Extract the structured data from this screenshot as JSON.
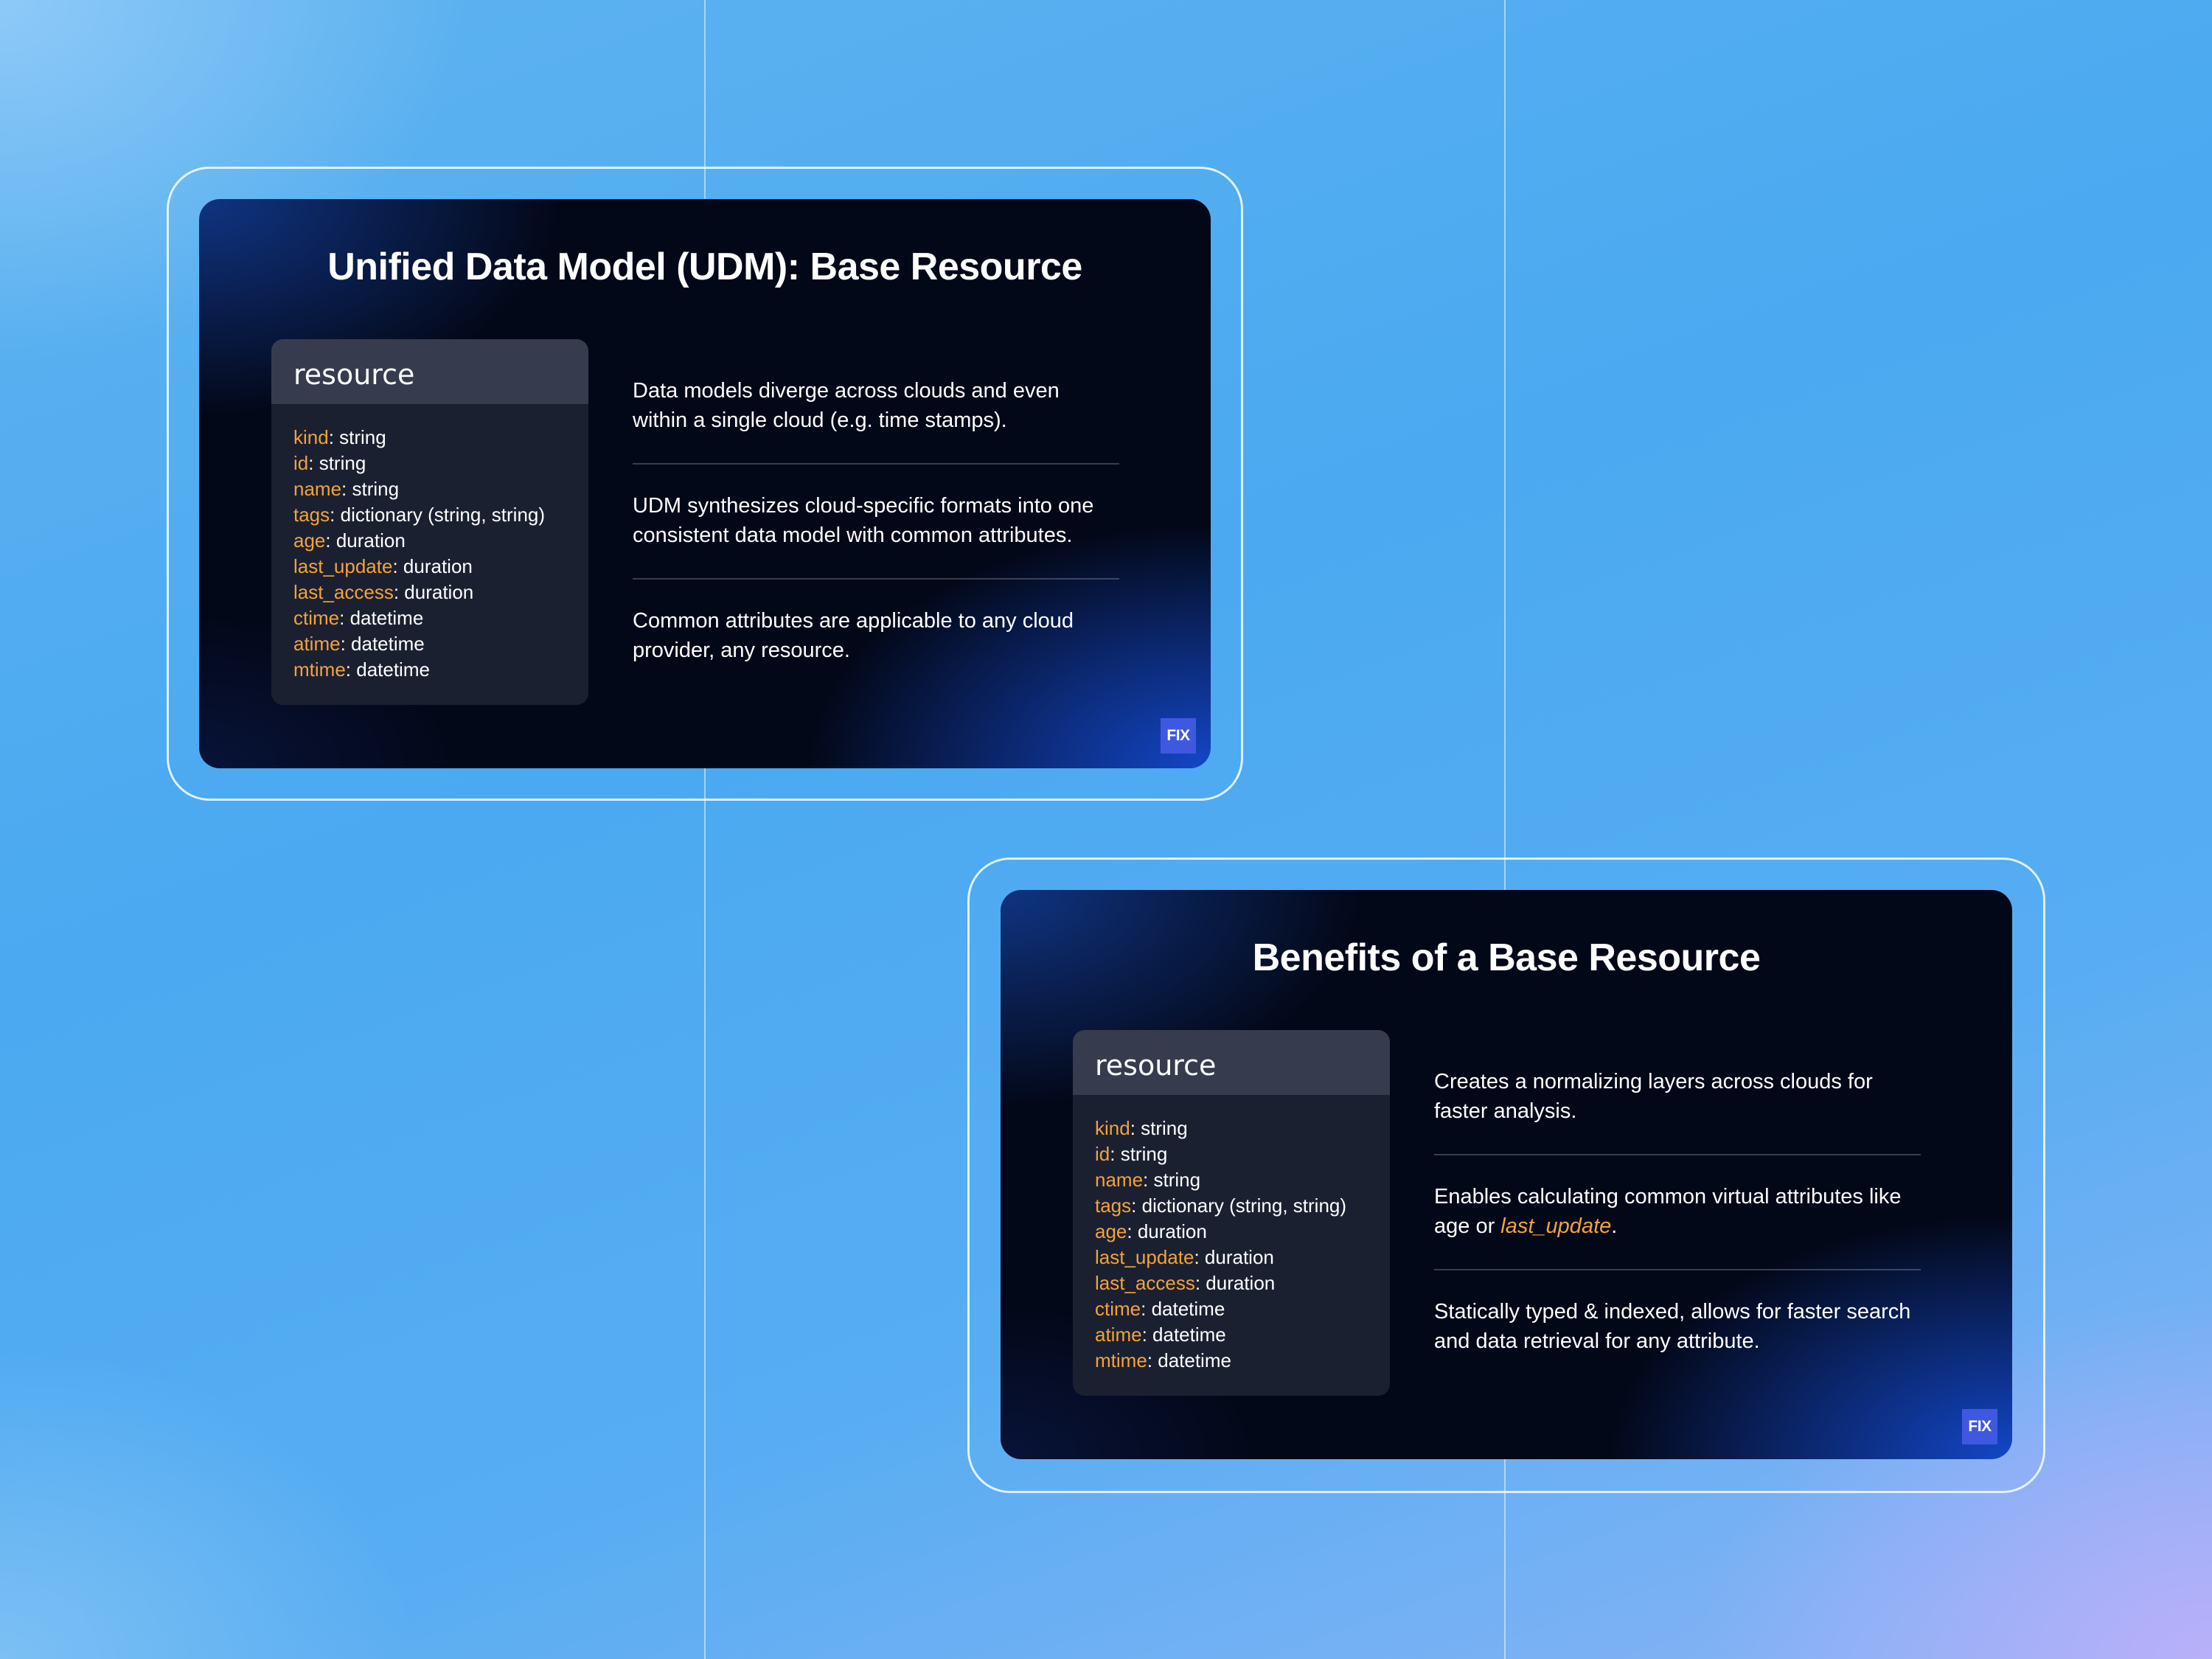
{
  "slides": [
    {
      "title": "Unified Data Model (UDM): Base Resource",
      "card": {
        "header": "resource",
        "fields": [
          {
            "key": "kind",
            "type": ": string"
          },
          {
            "key": "id",
            "type": ": string"
          },
          {
            "key": "name",
            "type": ": string"
          },
          {
            "key": "tags",
            "type": ": dictionary (string, string)"
          },
          {
            "key": "age",
            "type": ": duration"
          },
          {
            "key": "last_update",
            "type": ": duration"
          },
          {
            "key": "last_access",
            "type": ": duration"
          },
          {
            "key": "ctime",
            "type": ": datetime"
          },
          {
            "key": "atime",
            "type": ": datetime"
          },
          {
            "key": "mtime",
            "type": ": datetime"
          }
        ]
      },
      "points": [
        {
          "text": "Data models diverge across clouds and even within a single cloud (e.g. time stamps).",
          "highlight": "",
          "suffix": ""
        },
        {
          "text": "UDM synthesizes cloud-specific formats into one consistent data model with common attributes.",
          "highlight": "",
          "suffix": ""
        },
        {
          "text": "Common attributes are applicable to any cloud provider, any resource.",
          "highlight": "",
          "suffix": ""
        }
      ],
      "logo": "FIX"
    },
    {
      "title": "Benefits of a Base Resource",
      "card": {
        "header": "resource",
        "fields": [
          {
            "key": "kind",
            "type": ": string"
          },
          {
            "key": "id",
            "type": ": string"
          },
          {
            "key": "name",
            "type": ": string"
          },
          {
            "key": "tags",
            "type": ": dictionary (string, string)"
          },
          {
            "key": "age",
            "type": ": duration"
          },
          {
            "key": "last_update",
            "type": ": duration"
          },
          {
            "key": "last_access",
            "type": ": duration"
          },
          {
            "key": "ctime",
            "type": ": datetime"
          },
          {
            "key": "atime",
            "type": ": datetime"
          },
          {
            "key": "mtime",
            "type": ": datetime"
          }
        ]
      },
      "points": [
        {
          "text": "Creates a normalizing layers across clouds for faster analysis.",
          "highlight": "",
          "suffix": ""
        },
        {
          "text": "Enables calculating common virtual attributes like age or ",
          "highlight": "last_update",
          "suffix": "."
        },
        {
          "text": "Statically typed & indexed, allows for faster search and data retrieval for any attribute.",
          "highlight": "",
          "suffix": ""
        }
      ],
      "logo": "FIX"
    }
  ],
  "colors": {
    "field_key": "#f2a33a",
    "logo_background": "#3f58e0",
    "slide_background": "#030818",
    "card_header": "#363c4e",
    "card_body": "#1b2031"
  }
}
